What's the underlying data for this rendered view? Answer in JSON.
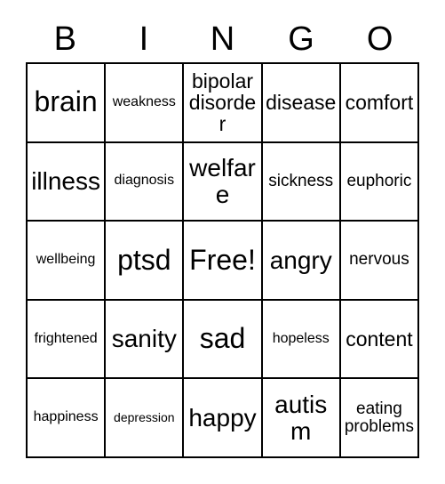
{
  "card": {
    "title_letters": [
      "B",
      "I",
      "N",
      "G",
      "O"
    ],
    "border_color": "#000000",
    "background_color": "#ffffff",
    "text_color": "#000000",
    "rows": 5,
    "columns": 5,
    "free_space": "Free!",
    "cells": [
      [
        {
          "label": "brain",
          "size": "xl"
        },
        {
          "label": "weakness",
          "size": "xs"
        },
        {
          "label": "bipolar disorder",
          "size": "md",
          "lines": 2
        },
        {
          "label": "disease",
          "size": "md"
        },
        {
          "label": "comfort",
          "size": "md"
        }
      ],
      [
        {
          "label": "illness",
          "size": "lg"
        },
        {
          "label": "diagnosis",
          "size": "xs"
        },
        {
          "label": "welfare",
          "size": "lg"
        },
        {
          "label": "sickness",
          "size": "sm"
        },
        {
          "label": "euphoric",
          "size": "sm"
        }
      ],
      [
        {
          "label": "wellbeing",
          "size": "xs"
        },
        {
          "label": "ptsd",
          "size": "xl"
        },
        {
          "label": "Free!",
          "size": "xl"
        },
        {
          "label": "angry",
          "size": "lg"
        },
        {
          "label": "nervous",
          "size": "sm"
        }
      ],
      [
        {
          "label": "frightened",
          "size": "xs"
        },
        {
          "label": "sanity",
          "size": "lg"
        },
        {
          "label": "sad",
          "size": "xl"
        },
        {
          "label": "hopeless",
          "size": "xs"
        },
        {
          "label": "content",
          "size": "md"
        }
      ],
      [
        {
          "label": "happiness",
          "size": "xs"
        },
        {
          "label": "depression",
          "size": "xxs"
        },
        {
          "label": "happy",
          "size": "lg"
        },
        {
          "label": "autism",
          "size": "lg"
        },
        {
          "label": "eating problems",
          "size": "sm",
          "lines": 2
        }
      ]
    ]
  }
}
